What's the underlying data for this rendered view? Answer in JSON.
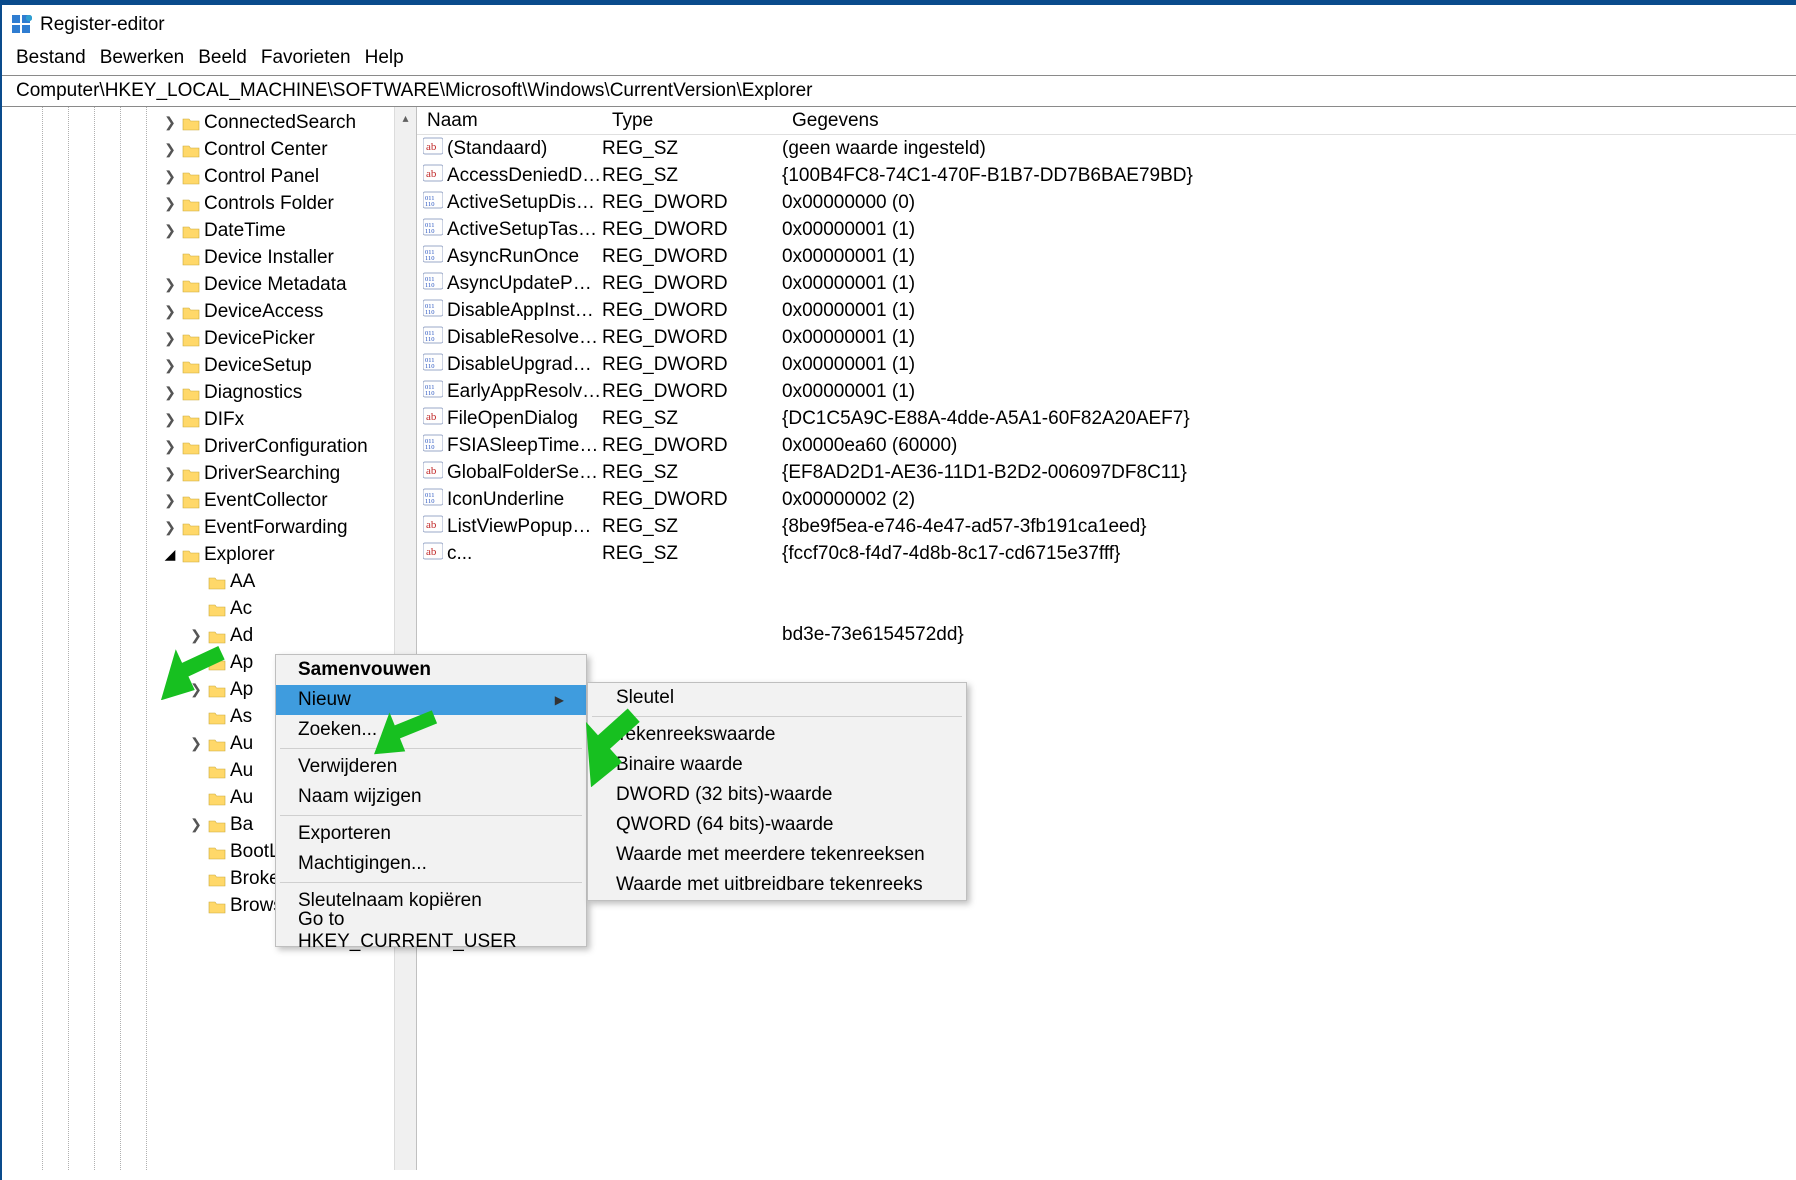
{
  "app": {
    "title": "Register-editor"
  },
  "menu": [
    "Bestand",
    "Bewerken",
    "Beeld",
    "Favorieten",
    "Help"
  ],
  "address": "Computer\\HKEY_LOCAL_MACHINE\\SOFTWARE\\Microsoft\\Windows\\CurrentVersion\\Explorer",
  "tree": [
    {
      "label": "ConnectedSearch",
      "tw": ">",
      "lvl": 0
    },
    {
      "label": "Control Center",
      "tw": ">",
      "lvl": 0
    },
    {
      "label": "Control Panel",
      "tw": ">",
      "lvl": 0
    },
    {
      "label": "Controls Folder",
      "tw": ">",
      "lvl": 0
    },
    {
      "label": "DateTime",
      "tw": ">",
      "lvl": 0
    },
    {
      "label": "Device Installer",
      "tw": "",
      "lvl": 0
    },
    {
      "label": "Device Metadata",
      "tw": ">",
      "lvl": 0
    },
    {
      "label": "DeviceAccess",
      "tw": ">",
      "lvl": 0
    },
    {
      "label": "DevicePicker",
      "tw": ">",
      "lvl": 0
    },
    {
      "label": "DeviceSetup",
      "tw": ">",
      "lvl": 0
    },
    {
      "label": "Diagnostics",
      "tw": ">",
      "lvl": 0
    },
    {
      "label": "DIFx",
      "tw": ">",
      "lvl": 0
    },
    {
      "label": "DriverConfiguration",
      "tw": ">",
      "lvl": 0
    },
    {
      "label": "DriverSearching",
      "tw": ">",
      "lvl": 0
    },
    {
      "label": "EventCollector",
      "tw": ">",
      "lvl": 0
    },
    {
      "label": "EventForwarding",
      "tw": ">",
      "lvl": 0
    },
    {
      "label": "Explorer",
      "tw": "v",
      "lvl": 0
    },
    {
      "label": "AA",
      "tw": "",
      "lvl": 1
    },
    {
      "label": "Ac",
      "tw": "",
      "lvl": 1
    },
    {
      "label": "Ad",
      "tw": ">",
      "lvl": 1
    },
    {
      "label": "Ap",
      "tw": "",
      "lvl": 1
    },
    {
      "label": "Ap",
      "tw": ">",
      "lvl": 1
    },
    {
      "label": "As",
      "tw": "",
      "lvl": 1
    },
    {
      "label": "Au",
      "tw": ">",
      "lvl": 1
    },
    {
      "label": "Au",
      "tw": "",
      "lvl": 1
    },
    {
      "label": "Au",
      "tw": "",
      "lvl": 1
    },
    {
      "label": "Ba",
      "tw": ">",
      "lvl": 1
    },
    {
      "label": "BootLocale",
      "tw": "",
      "lvl": 1
    },
    {
      "label": "BrokerExtensions",
      "tw": "",
      "lvl": 1
    },
    {
      "label": "BrowseNewProcess",
      "tw": "",
      "lvl": 1
    }
  ],
  "cols": {
    "name": "Naam",
    "type": "Type",
    "data": "Gegevens"
  },
  "values": [
    {
      "icon": "ab",
      "name": "(Standaard)",
      "type": "REG_SZ",
      "data": "(geen waarde ingesteld)"
    },
    {
      "icon": "ab",
      "name": "AccessDeniedDia...",
      "type": "REG_SZ",
      "data": "{100B4FC8-74C1-470F-B1B7-DD7B6BAE79BD}"
    },
    {
      "icon": "dw",
      "name": "ActiveSetupDisa...",
      "type": "REG_DWORD",
      "data": "0x00000000 (0)"
    },
    {
      "icon": "dw",
      "name": "ActiveSetupTask...",
      "type": "REG_DWORD",
      "data": "0x00000001 (1)"
    },
    {
      "icon": "dw",
      "name": "AsyncRunOnce",
      "type": "REG_DWORD",
      "data": "0x00000001 (1)"
    },
    {
      "icon": "dw",
      "name": "AsyncUpdatePCS...",
      "type": "REG_DWORD",
      "data": "0x00000001 (1)"
    },
    {
      "icon": "dw",
      "name": "DisableAppInstall...",
      "type": "REG_DWORD",
      "data": "0x00000001 (1)"
    },
    {
      "icon": "dw",
      "name": "DisableResolveSt...",
      "type": "REG_DWORD",
      "data": "0x00000001 (1)"
    },
    {
      "icon": "dw",
      "name": "DisableUpgradeC...",
      "type": "REG_DWORD",
      "data": "0x00000001 (1)"
    },
    {
      "icon": "dw",
      "name": "EarlyAppResolver...",
      "type": "REG_DWORD",
      "data": "0x00000001 (1)"
    },
    {
      "icon": "ab",
      "name": "FileOpenDialog",
      "type": "REG_SZ",
      "data": "{DC1C5A9C-E88A-4dde-A5A1-60F82A20AEF7}"
    },
    {
      "icon": "dw",
      "name": "FSIASleepTimeIn...",
      "type": "REG_DWORD",
      "data": "0x0000ea60 (60000)"
    },
    {
      "icon": "ab",
      "name": "GlobalFolderSetti...",
      "type": "REG_SZ",
      "data": "{EF8AD2D1-AE36-11D1-B2D2-006097DF8C11}"
    },
    {
      "icon": "dw",
      "name": "IconUnderline",
      "type": "REG_DWORD",
      "data": "0x00000002 (2)"
    },
    {
      "icon": "ab",
      "name": "ListViewPopupCo...",
      "type": "REG_SZ",
      "data": "{8be9f5ea-e746-4e47-ad57-3fb191ca1eed}"
    },
    {
      "icon": "ab",
      "name": "c...",
      "type": "REG_SZ",
      "data": "{fccf70c8-f4d7-4d8b-8c17-cd6715e37fff}"
    }
  ],
  "values_trail": "bd3e-73e6154572dd}",
  "ctx1": {
    "items": [
      {
        "label": "Samenvouwen",
        "bold": true
      },
      {
        "label": "Nieuw",
        "sub": true,
        "hover": true
      },
      {
        "label": "Zoeken..."
      },
      "sep",
      {
        "label": "Verwijderen"
      },
      {
        "label": "Naam wijzigen"
      },
      "sep",
      {
        "label": "Exporteren"
      },
      {
        "label": "Machtigingen..."
      },
      "sep",
      {
        "label": "Sleutelnaam kopiëren"
      },
      {
        "label": "Go to HKEY_CURRENT_USER"
      }
    ]
  },
  "ctx2": {
    "items": [
      "Sleutel",
      "sep",
      "Tekenreekswaarde",
      "Binaire waarde",
      "DWORD (32 bits)-waarde",
      "QWORD (64 bits)-waarde",
      "Waarde met meerdere tekenreeksen",
      "Waarde met uitbreidbare tekenreeks"
    ]
  }
}
